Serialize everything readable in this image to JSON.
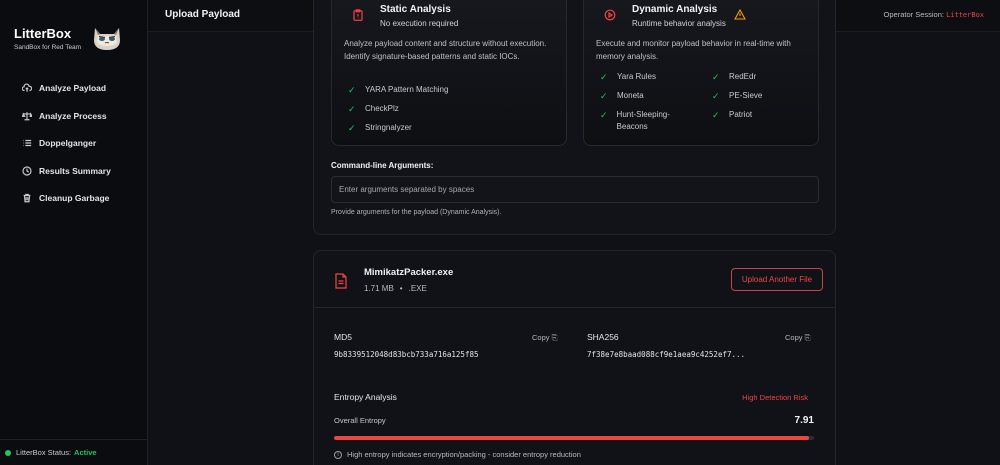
{
  "brand": {
    "name": "LitterBox",
    "tagline": "SandBox for Red Team"
  },
  "nav": [
    {
      "label": "Analyze Payload",
      "icon": "upload-cloud-icon"
    },
    {
      "label": "Analyze Process",
      "icon": "scale-icon"
    },
    {
      "label": "Doppelganger",
      "icon": "list-icon"
    },
    {
      "label": "Results Summary",
      "icon": "clock-icon"
    },
    {
      "label": "Cleanup Garbage",
      "icon": "trash-icon"
    }
  ],
  "status": {
    "label": "LitterBox Status:",
    "value": "Active"
  },
  "header": {
    "title": "Upload Payload",
    "session_label": "Operator Session:",
    "session_user": "LitterBox"
  },
  "static_card": {
    "title": "Static Analysis",
    "subtitle": "No execution required",
    "description": "Analyze payload content and structure without execution. Identify signature-based patterns and static IOCs.",
    "features": [
      "YARA Pattern Matching",
      "CheckPlz",
      "Stringnalyzer"
    ]
  },
  "dynamic_card": {
    "title": "Dynamic Analysis",
    "subtitle": "Runtime behavior analysis",
    "description": "Execute and monitor payload behavior in real-time with memory analysis.",
    "features_left": [
      "Yara Rules",
      "Moneta",
      "Hunt-Sleeping-Beacons"
    ],
    "features_right": [
      "RedEdr",
      "PE-Sieve",
      "Patriot"
    ]
  },
  "cmd": {
    "label": "Command-line Arguments:",
    "placeholder": "Enter arguments separated by spaces",
    "help": "Provide arguments for the payload (Dynamic Analysis)."
  },
  "file": {
    "name": "MimikatzPacker.exe",
    "size": "1.71 MB",
    "sep": "•",
    "ext": ".EXE",
    "upload_label": "Upload Another File",
    "md5_label": "MD5",
    "md5": "9b8339512048d83bcb733a716a125f85",
    "sha256_label": "SHA256",
    "sha256": "7f38e7e8baad088cf9e1aea9c4252ef7...",
    "copy_label": "Copy ⎘"
  },
  "entropy": {
    "title": "Entropy Analysis",
    "risk": "High Detection Risk",
    "label": "Overall Entropy",
    "value": "7.91",
    "fraction": 0.99,
    "note": "High entropy indicates encryption/packing - consider entropy reduction"
  },
  "colors": {
    "accent": "#ef4444",
    "success": "#22c55e"
  }
}
